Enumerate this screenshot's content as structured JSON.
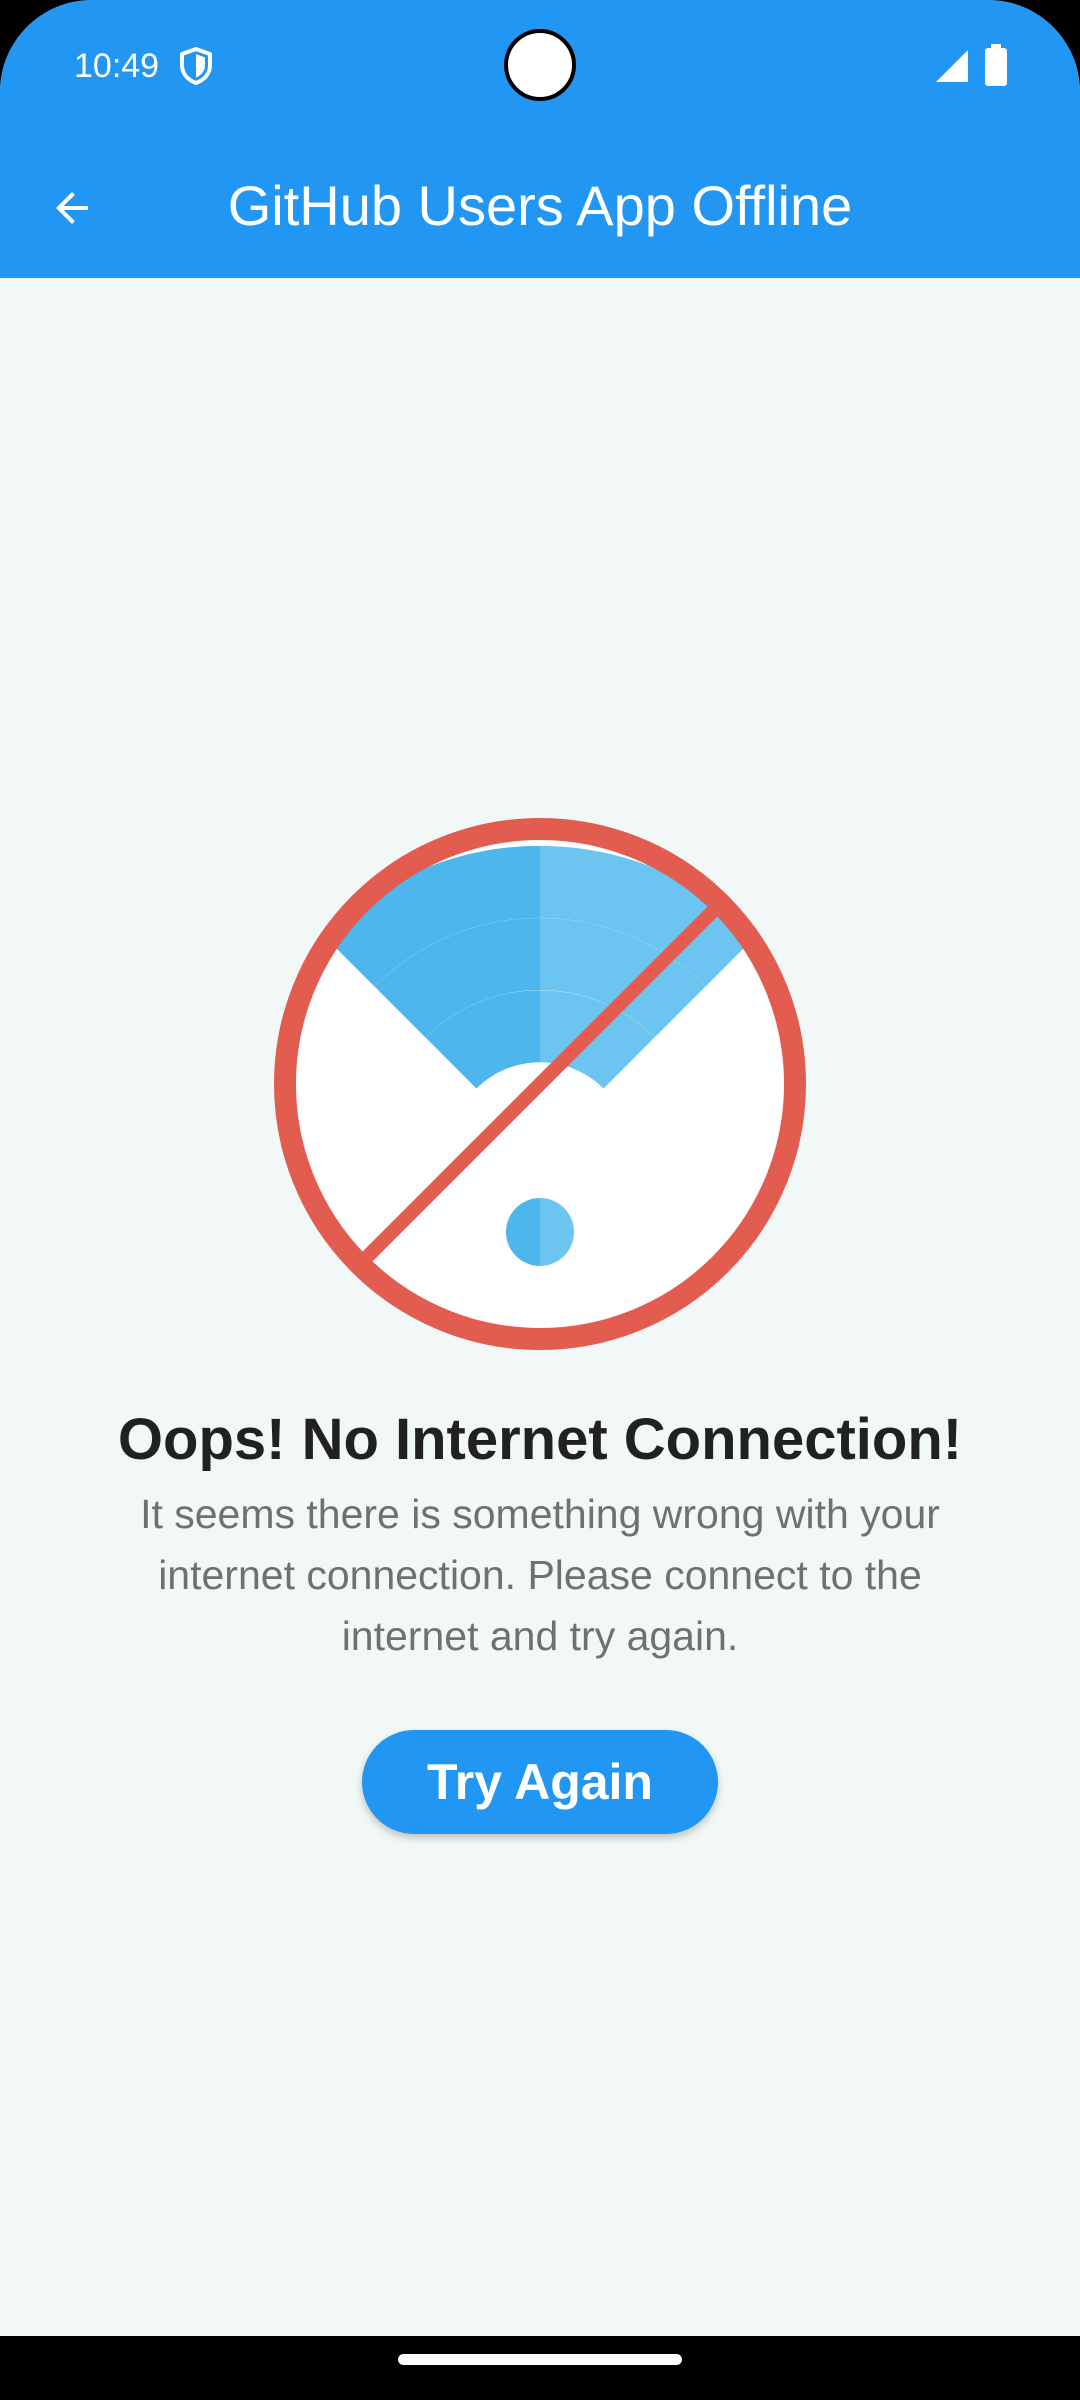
{
  "status_bar": {
    "time": "10:49",
    "icons": [
      "vpn-shield-icon",
      "cellular-signal-icon",
      "battery-icon"
    ]
  },
  "app_bar": {
    "title": "GitHub Users App Offline",
    "back_icon": "arrow-back-icon"
  },
  "offline": {
    "illustration": "wifi-off-icon",
    "headline": "Oops! No Internet Connection!",
    "message": "It seems there is something wrong with your internet connection. Please connect to the internet and try again.",
    "button_label": "Try Again"
  },
  "colors": {
    "primary": "#2196f3",
    "background": "#f2f8f8",
    "headline": "#212121",
    "message": "#707070",
    "wifi_light": "#6cc5f0",
    "wifi_dark": "#4db6ec",
    "prohibition_red": "#e25c4f"
  }
}
